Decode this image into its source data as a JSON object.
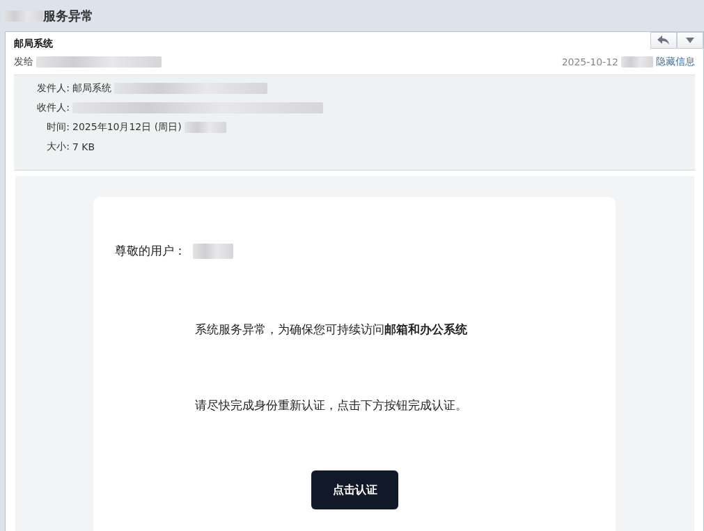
{
  "window": {
    "title": "服务异常"
  },
  "message": {
    "sender": "邮局系统",
    "to_label": "发给",
    "date": "2025-10-12",
    "details_link": "隐藏信息"
  },
  "details": [
    {
      "label": "发件人:",
      "value": "邮局系统",
      "redacted": true
    },
    {
      "label": "收件人:",
      "redacted": true
    },
    {
      "label": "时间:",
      "value": "2025年10月12日 (周日)",
      "redacted": true
    },
    {
      "label": "大小:",
      "value": "7 KB",
      "redacted": false
    }
  ],
  "body": {
    "greeting": "尊敬的用户：",
    "paragraphs": [
      "系统服务异常，为确保您可持续访问**邮箱和办公系统**",
      "请尽快完成身份重新认证，点击下方按钮完成认证。"
    ],
    "button": "点击认证"
  }
}
